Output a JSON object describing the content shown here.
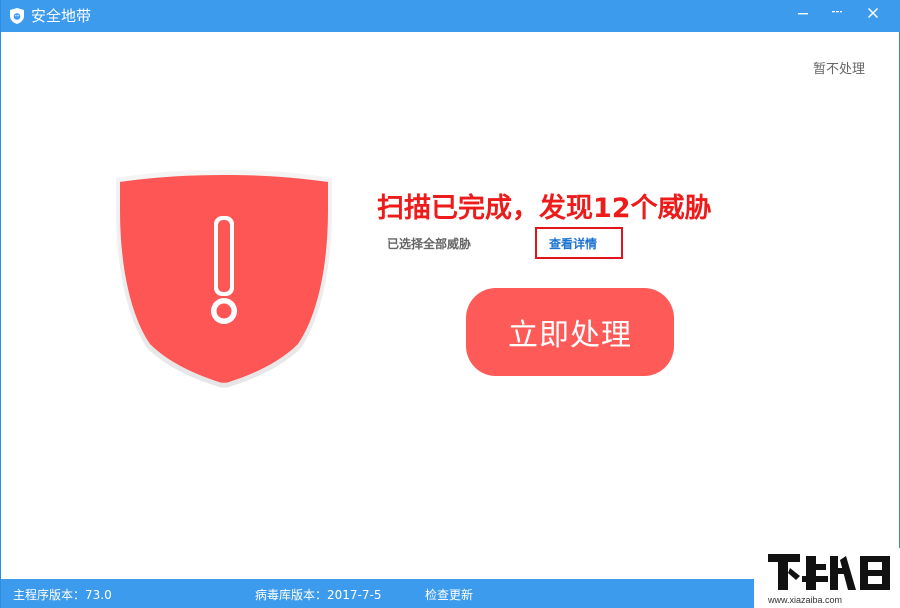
{
  "window": {
    "title": "安全地带",
    "controls": [
      "minimize-icon",
      "restore-icon",
      "close-icon"
    ]
  },
  "header": {
    "skip_label": "暂不处理"
  },
  "result": {
    "headline": "扫描已完成，发现12个威胁",
    "selection_note": "已选择全部威胁",
    "details_link": "查看详情"
  },
  "action": {
    "label": "立即处理"
  },
  "statusbar": {
    "main_version": "主程序版本：73.0",
    "virus_db_version": "病毒库版本：2017-7-5",
    "check_update": "检查更新"
  },
  "watermark": {
    "url": "www.xiazaiba.com"
  },
  "colors": {
    "titlebar": "#3d9bee",
    "alert_red": "#ee1b1b",
    "button_red": "#fd5a58",
    "link_blue": "#1a73d1"
  }
}
